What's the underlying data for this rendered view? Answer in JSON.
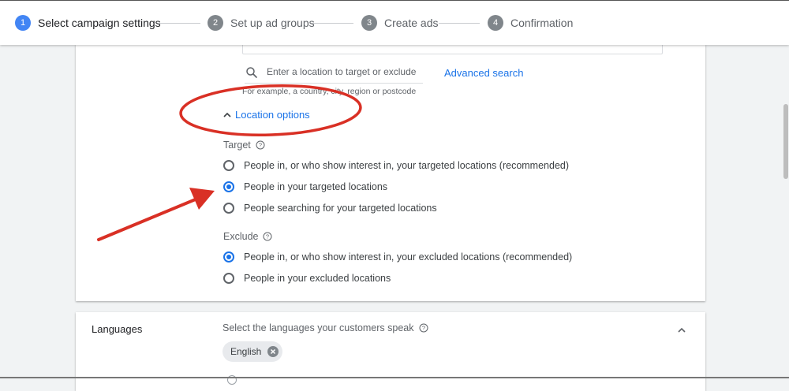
{
  "stepper": {
    "steps": [
      {
        "number": "1",
        "label": "Select campaign settings",
        "active": true
      },
      {
        "number": "2",
        "label": "Set up ad groups",
        "active": false
      },
      {
        "number": "3",
        "label": "Create ads",
        "active": false
      },
      {
        "number": "4",
        "label": "Confirmation",
        "active": false
      }
    ]
  },
  "locations": {
    "search_placeholder": "Enter a location to target or exclude",
    "advanced_search": "Advanced search",
    "helper_text": "For example, a country, city, region or postcode",
    "location_options_label": "Location options",
    "target": {
      "title": "Target",
      "options": [
        {
          "label": "People in, or who show interest in, your targeted locations (recommended)",
          "checked": false
        },
        {
          "label": "People in your targeted locations",
          "checked": true
        },
        {
          "label": "People searching for your targeted locations",
          "checked": false
        }
      ]
    },
    "exclude": {
      "title": "Exclude",
      "options": [
        {
          "label": "People in, or who show interest in, your excluded locations (recommended)",
          "checked": true
        },
        {
          "label": "People in your excluded locations",
          "checked": false
        }
      ]
    }
  },
  "languages": {
    "title": "Languages",
    "description": "Select the languages your customers speak",
    "selected_chip": "English"
  },
  "icons": {
    "search": "search-icon",
    "chevron_up": "chevron-up-icon",
    "help": "help-icon",
    "chip_remove": "close-circle-icon"
  },
  "colors": {
    "accent": "#1a73e8",
    "step_active": "#4285f4",
    "step_inactive": "#80868b",
    "annotation": "#d93025"
  }
}
